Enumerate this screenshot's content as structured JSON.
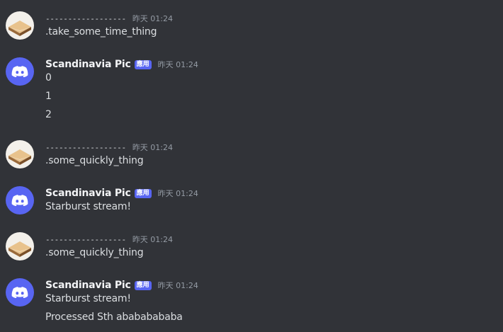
{
  "messages": [
    {
      "author": "------------------",
      "timestamp": "昨天 01:24",
      "lines": [
        ".take_some_time_thing"
      ]
    },
    {
      "author": "Scandinavia Pic",
      "badge": "應用",
      "timestamp": "昨天 01:24",
      "lines": [
        "0",
        "1",
        "2"
      ]
    },
    {
      "author": "------------------",
      "timestamp": "昨天 01:24",
      "lines": [
        ".some_quickly_thing"
      ]
    },
    {
      "author": "Scandinavia Pic",
      "badge": "應用",
      "timestamp": "昨天 01:24",
      "lines": [
        "Starburst stream!"
      ]
    },
    {
      "author": "------------------",
      "timestamp": "昨天 01:24",
      "lines": [
        ".some_quickly_thing"
      ]
    },
    {
      "author": "Scandinavia Pic",
      "badge": "應用",
      "timestamp": "昨天 01:24",
      "lines": [
        "Starburst stream!",
        "Processed Sth abababababa"
      ]
    }
  ],
  "colors": {
    "background": "#313338",
    "bot_avatar": "#5865f2",
    "app_badge": "#5865f2",
    "timestamp": "#949ba4",
    "text": "#dbdee1"
  },
  "icons": {
    "user_avatar": "sandwich-icon",
    "bot_avatar": "discord-logo-icon"
  }
}
